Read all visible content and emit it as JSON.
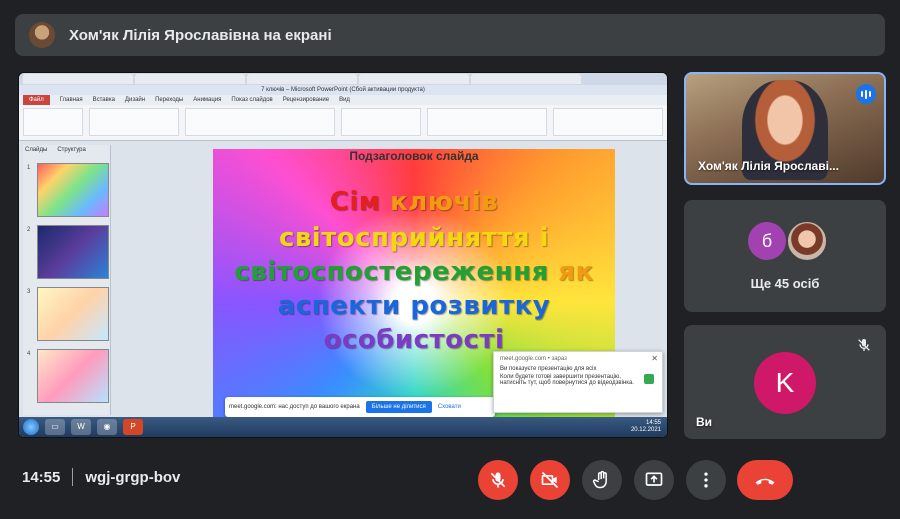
{
  "banner": {
    "title": "Хом'як Лілія Ярославівна на екрані"
  },
  "presentation": {
    "window_title": "7 ключів – Microsoft PowerPoint (Сбой активации продукта)",
    "menu": [
      "Файл",
      "Главная",
      "Вставка",
      "Дизайн",
      "Переходы",
      "Анимация",
      "Показ слайдов",
      "Рецензирование",
      "Вид"
    ],
    "left_tabs": [
      "Слайды",
      "Структура"
    ],
    "slide": {
      "subtitle": "Подзаголовок слайда",
      "line1": {
        "a": "Сім",
        "b": "ключів"
      },
      "line2": {
        "a": "світосприйняття",
        "b": "і"
      },
      "line3": {
        "a": "світоспостереження",
        "b": "як"
      },
      "line4": {
        "a": "аспекти",
        "b": "розвитку"
      },
      "line5": "особистості"
    },
    "share_notice": {
      "text": "meet.google.com: нас доступ до вашого екрана",
      "stop": "Більше не ділитися",
      "hide": "Сховати"
    },
    "popup": {
      "title": "meet.google.com • зараз",
      "heading": "Ви показуєте презентацію для всіх",
      "body": "Коли будете готові завершити презентацію, натисніть тут, щоб повернутися до відеодзвінка."
    },
    "taskbar": {
      "time": "14:55",
      "date": "20.12.2021"
    }
  },
  "tiles": {
    "presenter_name": "Хом'як Лілія Ярославі...",
    "others_initial": "б",
    "others_count": "Ще 45 осіб",
    "self_initial": "K",
    "self_label": "Ви"
  },
  "meeting": {
    "time": "14:55",
    "code": "wgj-grgp-bov"
  },
  "colors": {
    "background": "#202124",
    "panel": "#3c4043",
    "accent": "#8ab4f8",
    "danger": "#ea4335",
    "self_avatar": "#d01868",
    "other_avatar": "#a142b0"
  }
}
